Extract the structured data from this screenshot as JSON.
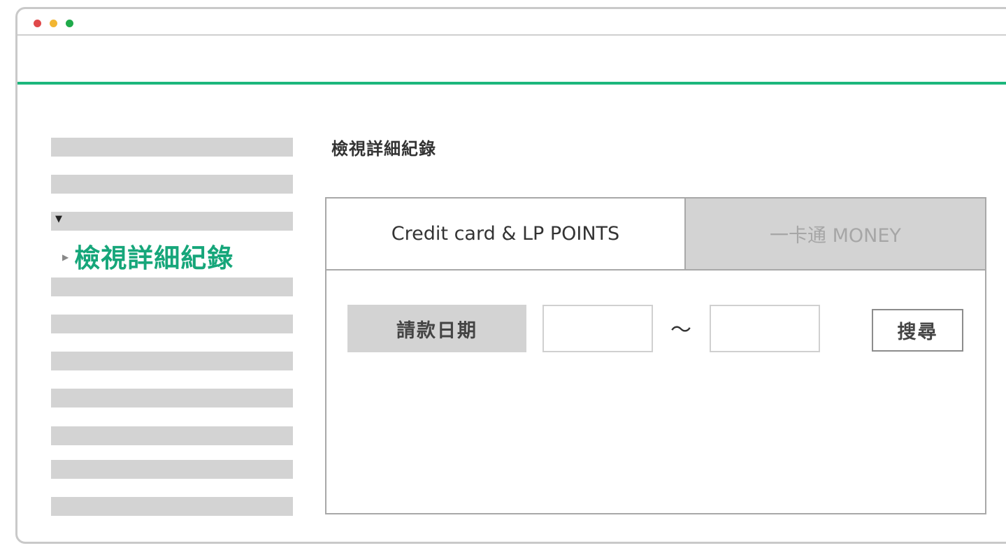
{
  "sidebar": {
    "active_item": "檢視詳細紀錄",
    "expand_caret": "▼",
    "active_arrow": "▶"
  },
  "main": {
    "title": "檢視詳細紀錄",
    "tabs": [
      {
        "label": "Credit card & LP POINTS",
        "active": true
      },
      {
        "label": "一卡通 MONEY",
        "active": false
      }
    ],
    "filter": {
      "label": "請款日期",
      "start_value": "",
      "end_value": "",
      "separator": "～",
      "search_label": "搜尋"
    }
  },
  "colors": {
    "accent": "#1cb77c",
    "active_text": "#16a67a",
    "placeholder_gray": "#d3d3d3"
  }
}
